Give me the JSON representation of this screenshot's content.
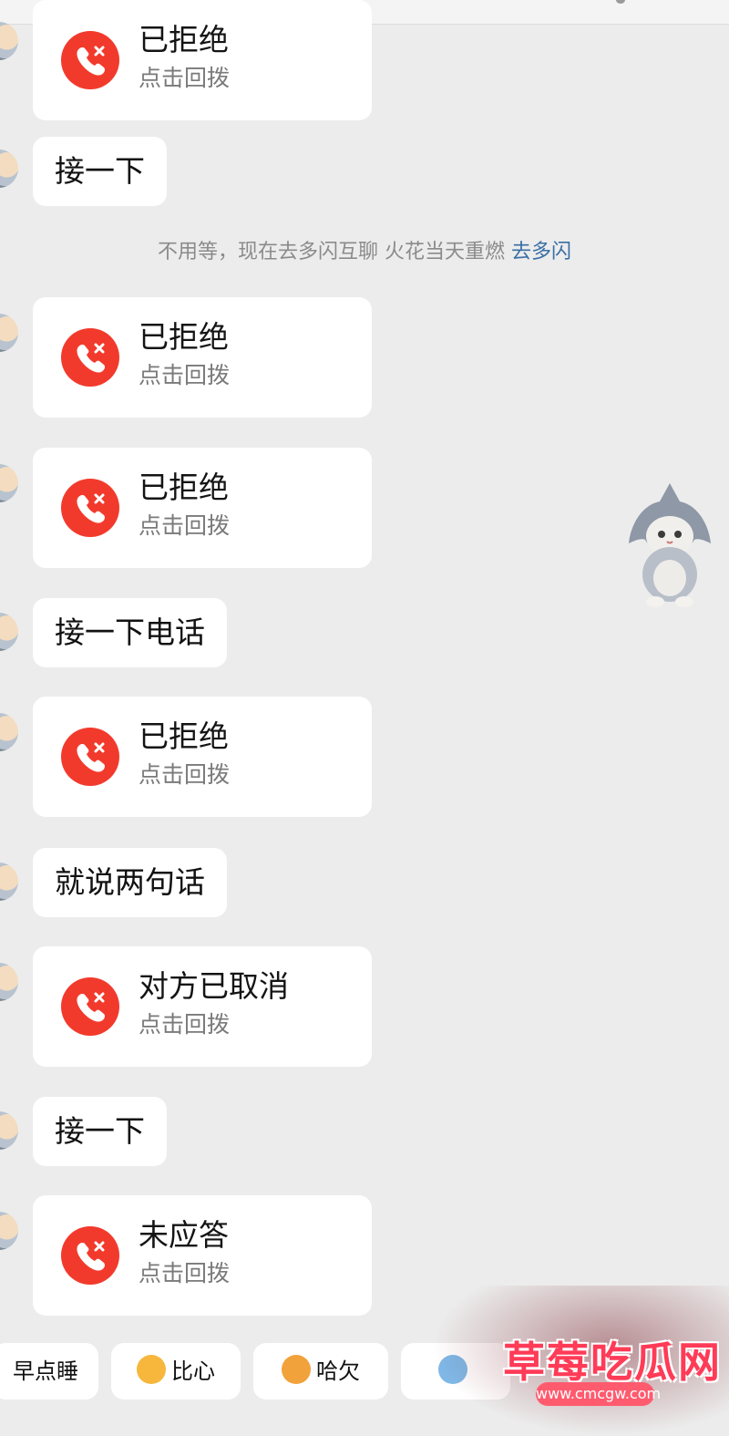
{
  "notice": {
    "text": "不用等，现在去多闪互聊 火花当天重燃",
    "link": "去多闪"
  },
  "messages": [
    {
      "kind": "call",
      "title": "已拒绝",
      "sub": "点击回拨"
    },
    {
      "kind": "text",
      "text": "接一下"
    },
    {
      "kind": "call",
      "title": "已拒绝",
      "sub": "点击回拨"
    },
    {
      "kind": "call",
      "title": "已拒绝",
      "sub": "点击回拨"
    },
    {
      "kind": "text",
      "text": "接一下电话"
    },
    {
      "kind": "call",
      "title": "已拒绝",
      "sub": "点击回拨"
    },
    {
      "kind": "text",
      "text": "就说两句话"
    },
    {
      "kind": "call",
      "title": "对方已取消",
      "sub": "点击回拨"
    },
    {
      "kind": "text",
      "text": "接一下"
    },
    {
      "kind": "call",
      "title": "未应答",
      "sub": "点击回拨"
    }
  ],
  "quick_replies": [
    {
      "label": "早点睡",
      "emoji": ""
    },
    {
      "label": "比心",
      "emoji": "duck-heart-emoji"
    },
    {
      "label": "哈欠",
      "emoji": "yawn-emoji"
    },
    {
      "label": "",
      "emoji": "cry-emoji"
    }
  ],
  "colors": {
    "call_icon": "#f23a2c",
    "link": "#3a6ea5",
    "background": "#ececec",
    "bubble": "#ffffff"
  },
  "sticker": {
    "icon": "cat-in-shark-hood-sticker"
  },
  "watermark": {
    "text": "草莓吃瓜网",
    "url": "www.cmcgw.com"
  }
}
